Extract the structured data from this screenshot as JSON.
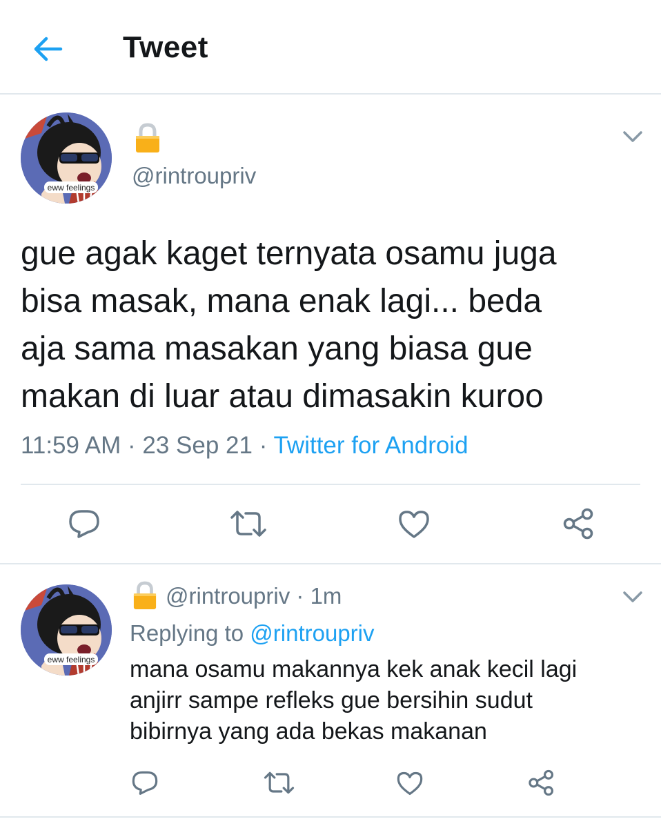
{
  "header": {
    "title": "Tweet",
    "back_icon": "arrow-left-icon",
    "accent_color": "#1da1f2"
  },
  "main_tweet": {
    "avatar_caption": "eww feelings",
    "lock_icon": "lock-icon",
    "handle": "@rintroupriv",
    "text": "gue agak kaget ternyata osamu juga\nbisa masak, mana enak lagi... beda\naja sama masakan yang biasa gue\nmakan di luar atau dimasakin kuroo",
    "time": "11:59 AM",
    "sep": "·",
    "date": "23 Sep 21",
    "source": "Twitter for Android",
    "actions": [
      "reply-icon",
      "retweet-icon",
      "like-icon",
      "share-icon"
    ]
  },
  "reply_tweet": {
    "avatar_caption": "eww feelings",
    "lock_icon": "lock-icon",
    "handle": "@rintroupriv",
    "sep": "·",
    "time_ago": "1m",
    "replying_prefix": "Replying to",
    "replying_to": "@rintroupriv",
    "text": "mana osamu makannya kek anak kecil lagi\nanjirr sampe refleks gue bersihin sudut\nbibirnya yang ada bekas makanan",
    "actions": [
      "reply-icon",
      "retweet-icon",
      "like-icon",
      "share-icon"
    ]
  }
}
